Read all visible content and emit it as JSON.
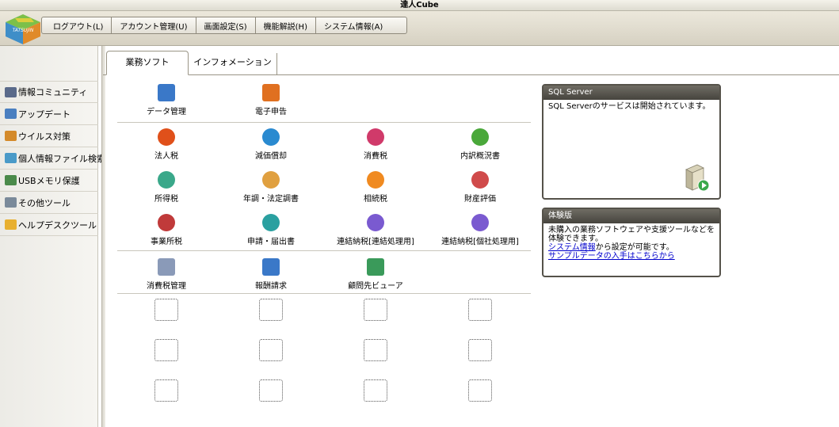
{
  "window": {
    "title": "達人Cube"
  },
  "logo": {
    "text": "TATSUJIN",
    "icon": "cube-logo-icon"
  },
  "menu": [
    {
      "label": "ログアウト(L)"
    },
    {
      "label": "アカウント管理(U)"
    },
    {
      "label": "画面設定(S)"
    },
    {
      "label": "機能解説(H)"
    },
    {
      "label": "システム情報(A)"
    }
  ],
  "sidebar": {
    "items": [
      {
        "label": "情報コミュニティ",
        "icon": "community-icon",
        "color": "#5a6a8a"
      },
      {
        "label": "アップデート",
        "icon": "update-icon",
        "color": "#4a7fc0"
      },
      {
        "label": "ウイルス対策",
        "icon": "antivirus-icon",
        "color": "#d48a2a"
      },
      {
        "label": "個人情報ファイル検索",
        "icon": "file-search-icon",
        "color": "#4a9ac8"
      },
      {
        "label": "USBメモリ保護",
        "icon": "usb-icon",
        "color": "#4a8a4a"
      },
      {
        "label": "その他ツール",
        "icon": "tools-icon",
        "color": "#7a8a9a"
      },
      {
        "label": "ヘルプデスクツール",
        "icon": "helpdesk-icon",
        "color": "#e8b030"
      }
    ]
  },
  "tabs": [
    {
      "label": "業務ソフト"
    },
    {
      "label": "インフォメーション"
    }
  ],
  "apps": {
    "row1": [
      {
        "label": "データ管理",
        "icon": "data-management-icon",
        "color": "#3a78c8"
      },
      {
        "label": "電子申告",
        "icon": "e-filing-icon",
        "color": "#e07020"
      }
    ],
    "row2": [
      {
        "label": "法人税",
        "icon": "corporate-tax-icon",
        "color": "#e0501a"
      },
      {
        "label": "減価償却",
        "icon": "depreciation-icon",
        "color": "#2a8ad0"
      },
      {
        "label": "消費税",
        "icon": "consumption-tax-icon",
        "color": "#d03a6a"
      },
      {
        "label": "内訳概況書",
        "icon": "breakdown-icon",
        "color": "#4aa83a"
      }
    ],
    "row3": [
      {
        "label": "所得税",
        "icon": "income-tax-icon",
        "color": "#3aa88a"
      },
      {
        "label": "年調・法定調書",
        "icon": "year-end-icon",
        "color": "#e0a040"
      },
      {
        "label": "相続税",
        "icon": "inheritance-tax-icon",
        "color": "#f08a20"
      },
      {
        "label": "財産評価",
        "icon": "property-valuation-icon",
        "color": "#d04a4a"
      }
    ],
    "row4": [
      {
        "label": "事業所税",
        "icon": "business-office-tax-icon",
        "color": "#c03a3a"
      },
      {
        "label": "申請・届出書",
        "icon": "application-icon",
        "color": "#2aa0a0"
      },
      {
        "label": "連結納税[連結処理用]",
        "icon": "consolidated-tax-icon",
        "color": "#7a5ad0"
      },
      {
        "label": "連結納税[個社処理用]",
        "icon": "consolidated-individual-icon",
        "color": "#7a5ad0"
      }
    ],
    "row5": [
      {
        "label": "消費税管理",
        "icon": "consumption-tax-management-icon",
        "color": "#8a9ab8"
      },
      {
        "label": "報酬請求",
        "icon": "fee-billing-icon",
        "color": "#3a78c8"
      },
      {
        "label": "顧問先ビューア",
        "icon": "client-viewer-icon",
        "color": "#3a9a5a"
      }
    ]
  },
  "sqlserver": {
    "title": "SQL Server",
    "message": "SQL Serverのサービスは開始されています。",
    "icon": "server-icon"
  },
  "trial": {
    "title": "体験版",
    "line1": "未購入の業務ソフトウェアや支援ツールなどを体験できます。",
    "link1": "システム情報",
    "line2": "から設定が可能です。",
    "link2": "サンプルデータの入手はこちらから"
  }
}
